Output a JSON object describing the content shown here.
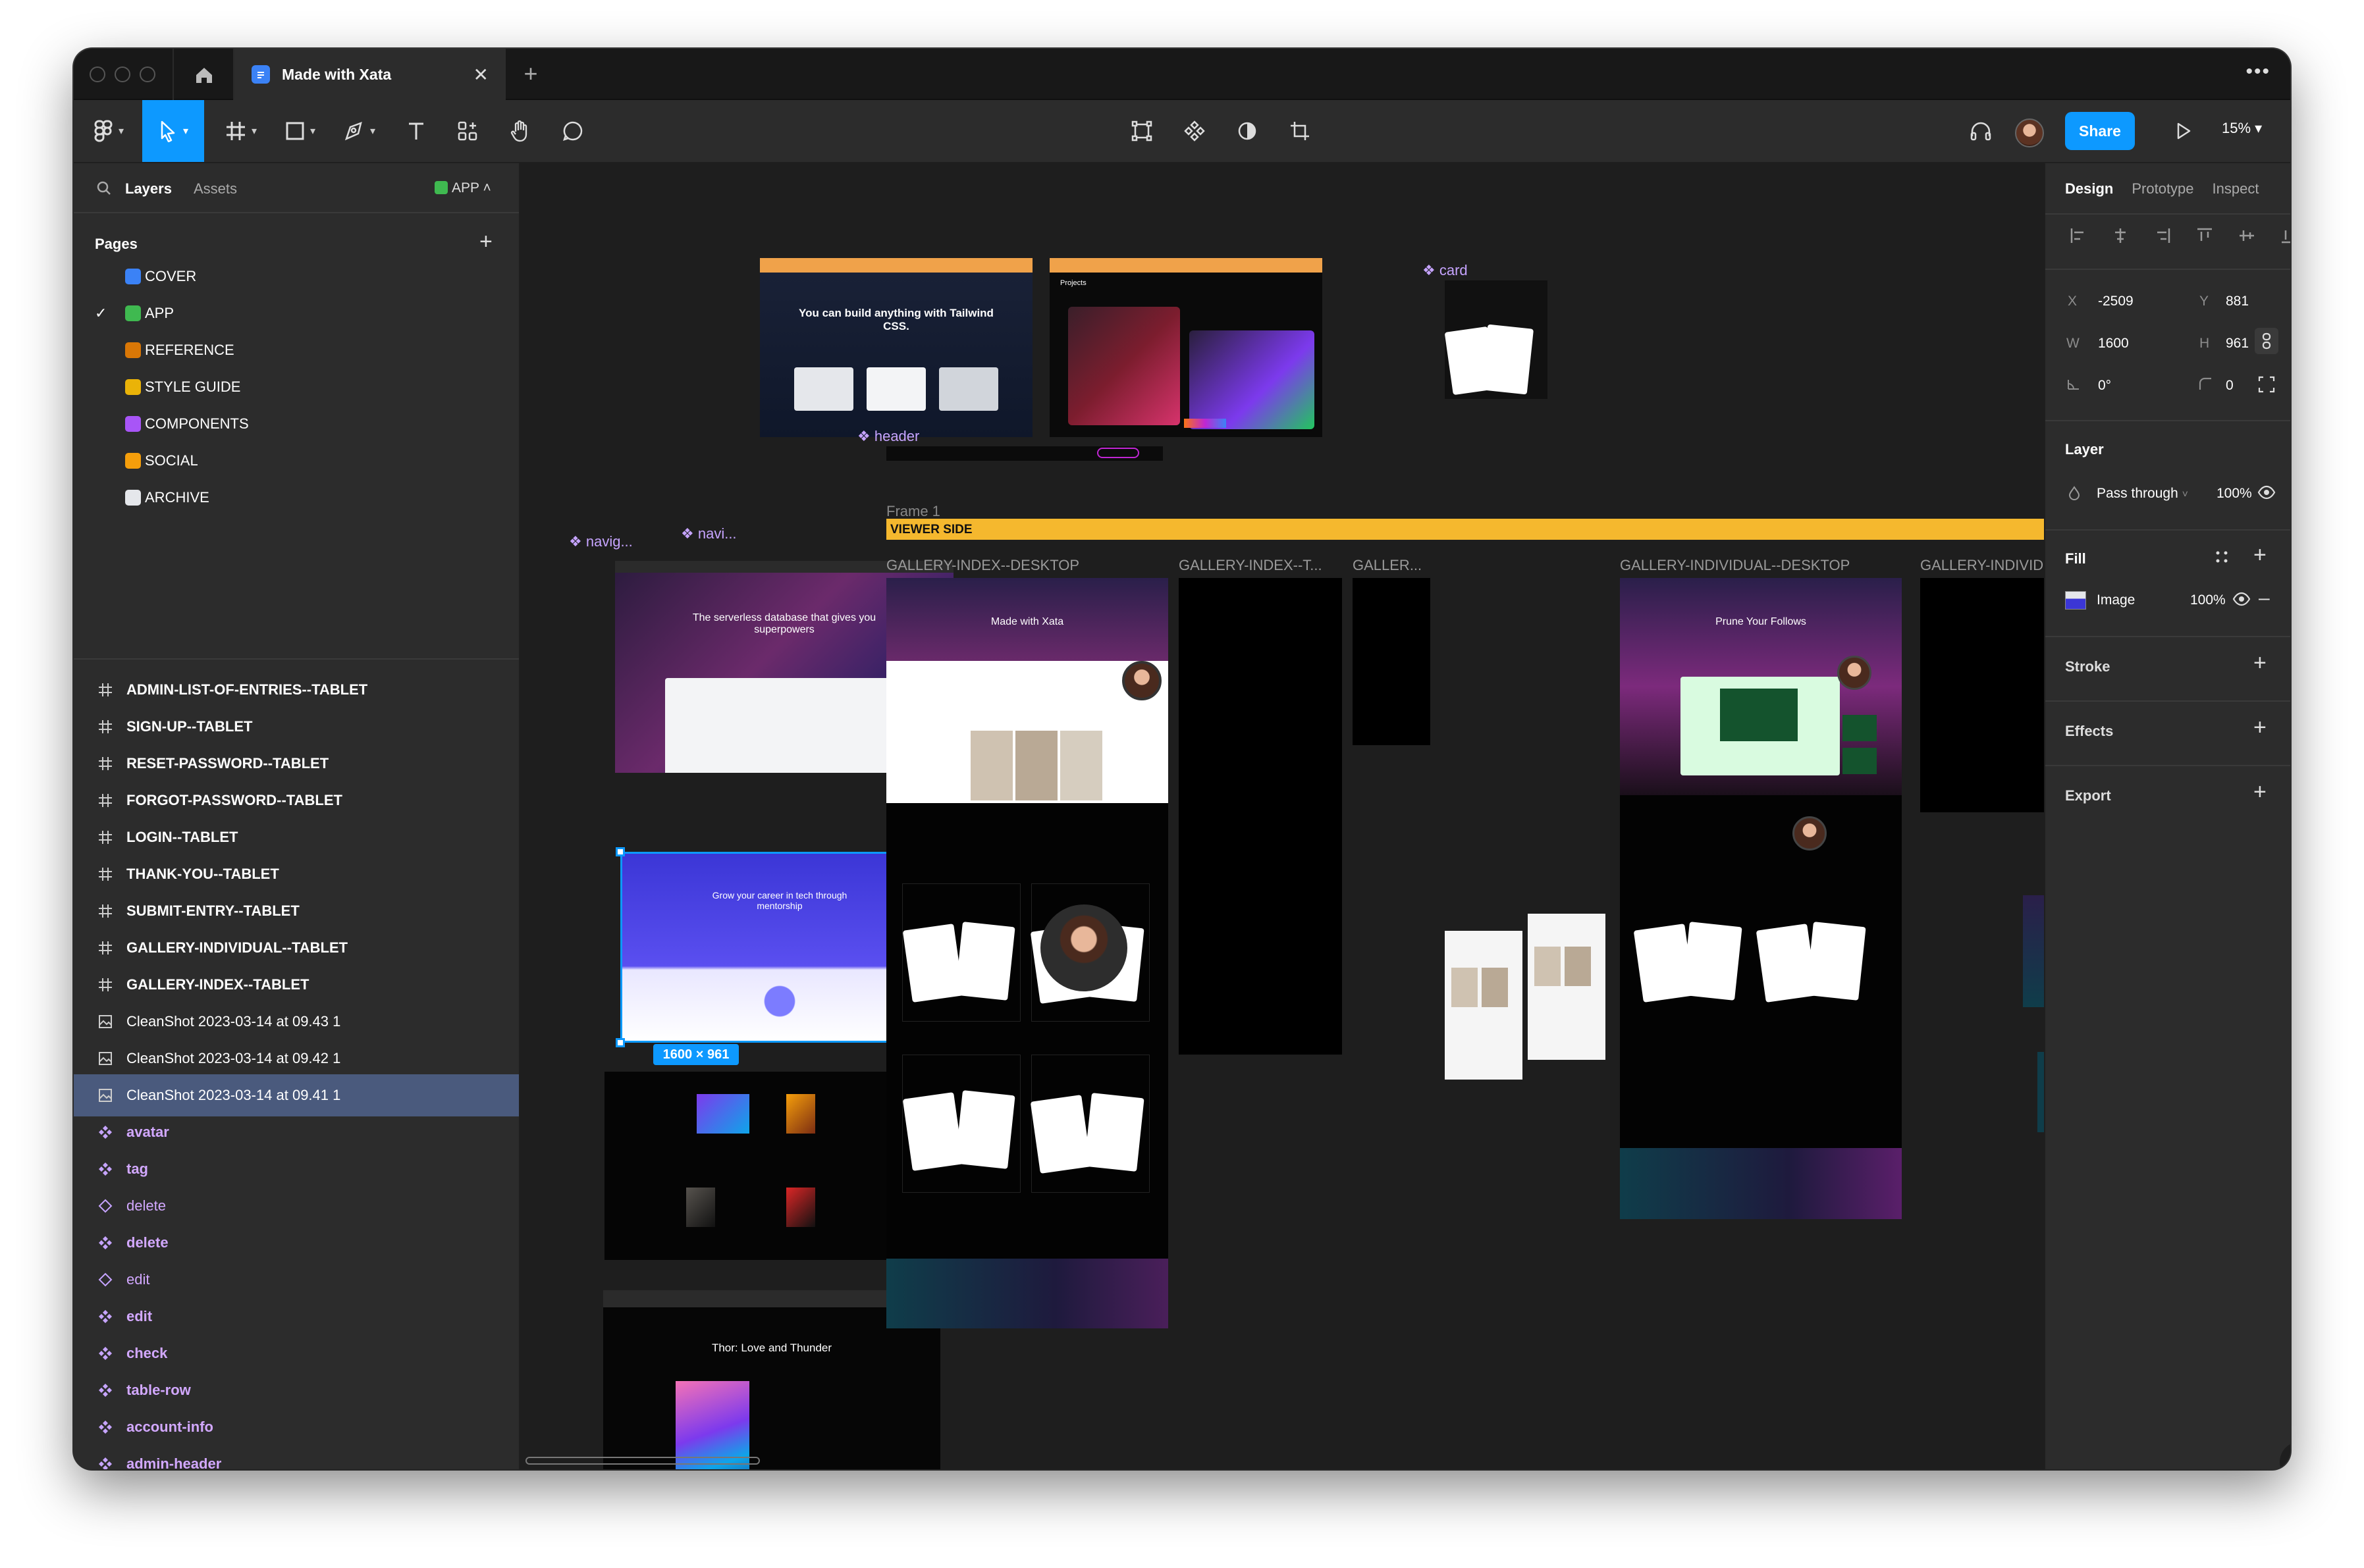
{
  "window": {
    "tab_title": "Made with Xata"
  },
  "toolbar": {
    "share_label": "Share",
    "zoom": "15%"
  },
  "left_panel": {
    "tabs": {
      "layers": "Layers",
      "assets": "Assets"
    },
    "page_selector": "APP",
    "pages_title": "Pages",
    "pages": [
      {
        "label": "COVER",
        "icon": "blue-cap-icon"
      },
      {
        "label": "APP",
        "icon": "green-check-icon",
        "current": true
      },
      {
        "label": "REFERENCE",
        "icon": "books-icon"
      },
      {
        "label": "STYLE GUIDE",
        "icon": "pencil-icon"
      },
      {
        "label": "COMPONENTS",
        "icon": "purple-box-icon"
      },
      {
        "label": "SOCIAL",
        "icon": "trumpet-icon"
      },
      {
        "label": "ARCHIVE",
        "icon": "skull-icon"
      }
    ],
    "layers": [
      {
        "label": "ADMIN-LIST-OF-ENTRIES--TABLET",
        "kind": "frame"
      },
      {
        "label": "SIGN-UP--TABLET",
        "kind": "frame"
      },
      {
        "label": "RESET-PASSWORD--TABLET",
        "kind": "frame"
      },
      {
        "label": "FORGOT-PASSWORD--TABLET",
        "kind": "frame"
      },
      {
        "label": "LOGIN--TABLET",
        "kind": "frame"
      },
      {
        "label": "THANK-YOU--TABLET",
        "kind": "frame"
      },
      {
        "label": "SUBMIT-ENTRY--TABLET",
        "kind": "frame"
      },
      {
        "label": "GALLERY-INDIVIDUAL--TABLET",
        "kind": "frame"
      },
      {
        "label": "GALLERY-INDEX--TABLET",
        "kind": "frame"
      },
      {
        "label": "CleanShot 2023-03-14 at 09.43 1",
        "kind": "image"
      },
      {
        "label": "CleanShot 2023-03-14 at 09.42 1",
        "kind": "image"
      },
      {
        "label": "CleanShot 2023-03-14 at 09.41 1",
        "kind": "image",
        "selected": true
      },
      {
        "label": "avatar",
        "kind": "component"
      },
      {
        "label": "tag",
        "kind": "component"
      },
      {
        "label": "delete",
        "kind": "instance"
      },
      {
        "label": "delete",
        "kind": "component"
      },
      {
        "label": "edit",
        "kind": "instance"
      },
      {
        "label": "edit",
        "kind": "component"
      },
      {
        "label": "check",
        "kind": "component"
      },
      {
        "label": "table-row",
        "kind": "component"
      },
      {
        "label": "account-info",
        "kind": "component"
      },
      {
        "label": "admin-header",
        "kind": "component"
      }
    ]
  },
  "canvas": {
    "frame_labels": {
      "gallery_index_desktop": "GALLERY-INDEX--DESKTOP",
      "gallery_index_t": "GALLERY-INDEX--T...",
      "galler": "GALLER...",
      "gallery_individual_desktop": "GALLERY-INDIVIDUAL--DESKTOP",
      "gallery_individ": "GALLERY-INDIVID"
    },
    "component_labels": {
      "card": "card",
      "header": "header",
      "navig": "navig...",
      "navi": "navi..."
    },
    "frame1": "Frame 1",
    "banner": "VIEWER SIDE",
    "selection_size": "1600 × 961",
    "thumb_text": {
      "tailwind": "You can build anything with Tailwind CSS.",
      "projects": "Projects",
      "xata_hero": "The serverless database that gives you superpowers",
      "tuau": "Grow your career in tech through mentorship",
      "made_with_xata": "Made with Xata",
      "prune": "Prune Your Follows",
      "thor": "Thor: Love and Thunder"
    }
  },
  "right_panel": {
    "tabs": {
      "design": "Design",
      "prototype": "Prototype",
      "inspect": "Inspect"
    },
    "x_label": "X",
    "x": "-2509",
    "y_label": "Y",
    "y": "881",
    "w_label": "W",
    "w": "1600",
    "h_label": "H",
    "h": "961",
    "rotation": "0°",
    "radius": "0",
    "layer_title": "Layer",
    "blend": "Pass through",
    "layer_opacity": "100%",
    "fill_title": "Fill",
    "fill_type": "Image",
    "fill_opacity": "100%",
    "stroke_title": "Stroke",
    "effects_title": "Effects",
    "export_title": "Export",
    "help": "?"
  },
  "colors": {
    "accent": "#0d99ff",
    "banner": "#f5b82e",
    "component": "#c6a4ff"
  }
}
